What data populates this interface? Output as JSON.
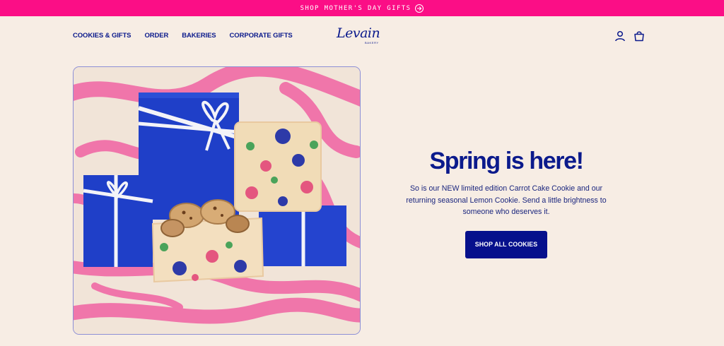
{
  "promo": {
    "text": "SHOP MOTHER'S DAY GIFTS",
    "icon": "arrow-right-circle-icon"
  },
  "header": {
    "nav": [
      "COOKIES & GIFTS",
      "ORDER",
      "BAKERIES",
      "CORPORATE GIFTS"
    ],
    "logo": {
      "word": "Levain",
      "sub": "BAKERY"
    },
    "icons": [
      "account-icon",
      "shopping-bag-icon"
    ]
  },
  "hero": {
    "title": "Spring is here!",
    "description": "So is our NEW limited edition Carrot Cake Cookie and our returning seasonal Lemon Cookie. Send a little brightness to someone who deserves it.",
    "cta_label": "SHOP ALL COOKIES",
    "image_subject": "gift-boxes-photo"
  },
  "colors": {
    "promo_bg": "#fb0e86",
    "page_bg": "#f7ede4",
    "brand_blue": "#0b1a8c",
    "button_bg": "#06108c"
  }
}
